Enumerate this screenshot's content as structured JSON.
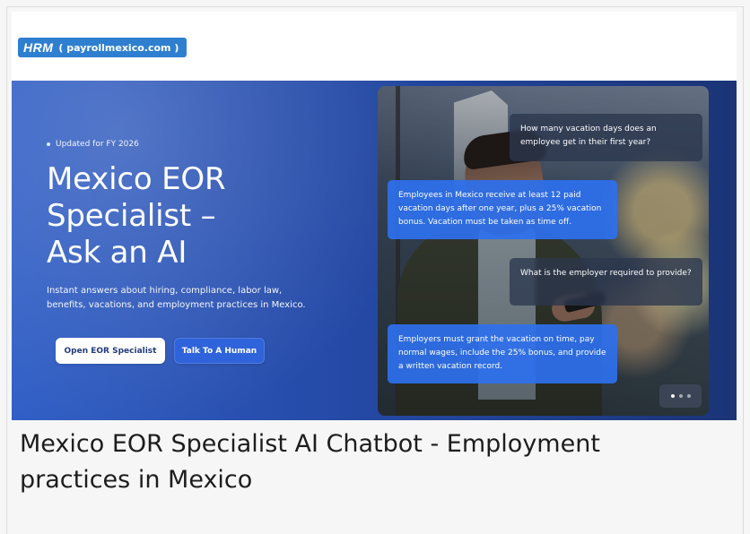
{
  "logo": {
    "brand": "HRM",
    "domain": "( payrollmexico.com )",
    "icon": "hrm-logo-icon"
  },
  "hero": {
    "updated": "Updated for FY 2026",
    "headline_line1": "Mexico EOR",
    "headline_line2": "Specialist –",
    "headline_line3": "Ask an AI",
    "subtext": "Instant answers about hiring, compliance, labor law, benefits, vacations, and employment practices in Mexico.",
    "primary_button": "Open EOR Specialist",
    "secondary_button": "Talk To A Human"
  },
  "chat": {
    "messages": [
      {
        "sender": "user",
        "text": "How many vacation days does an employee get in their first year?"
      },
      {
        "sender": "ai",
        "text": "Employees in Mexico receive at least 12 paid vacation days after one year, plus a 25% vacation bonus. Vacation must be taken as time off."
      },
      {
        "sender": "user",
        "text": "What is the employer required to provide?"
      },
      {
        "sender": "ai",
        "text": "Employers must grant the vacation on time, pay normal wages, include the 25% bonus, and provide a written vacation record."
      }
    ],
    "carousel_dots": 3,
    "active_dot": 1
  },
  "caption": "Mexico EOR Specialist AI Chatbot - Employment practices in Mexico",
  "colors": {
    "accent": "#2f7fd0",
    "hero_start": "#315fc6",
    "hero_end": "#1a3476",
    "ai_bubble": "#2e70ee",
    "user_bubble": "#2c374e"
  }
}
